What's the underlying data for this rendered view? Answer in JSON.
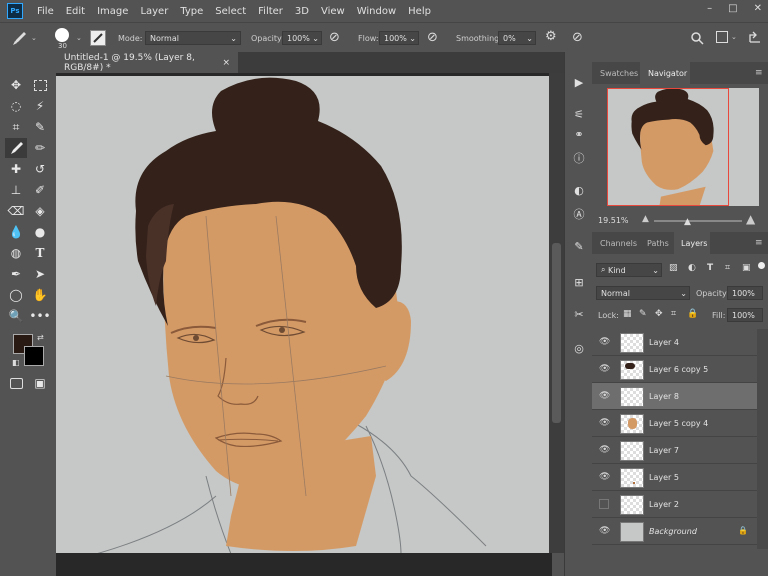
{
  "menubar": {
    "logo": "Ps",
    "items": [
      "File",
      "Edit",
      "Image",
      "Layer",
      "Type",
      "Select",
      "Filter",
      "3D",
      "View",
      "Window",
      "Help"
    ],
    "window_controls": [
      "–",
      "□",
      "✕"
    ]
  },
  "options": {
    "brush_size": "30",
    "mode_label": "Mode:",
    "mode_value": "Normal",
    "opacity_label": "Opacity:",
    "opacity_value": "100%",
    "flow_label": "Flow:",
    "flow_value": "100%",
    "smoothing_label": "Smoothing:",
    "smoothing_value": "0%"
  },
  "document": {
    "tab_title": "Untitled-1 @ 19.5% (Layer 8, RGB/8#) *",
    "close": "×"
  },
  "navigator": {
    "tabs": [
      "Swatches",
      "Navigator"
    ],
    "zoom": "19.51%"
  },
  "layers_panel": {
    "tabs": [
      "Channels",
      "Paths",
      "Layers"
    ],
    "filter_value": "Kind",
    "blend_mode": "Normal",
    "opacity_label": "Opacity:",
    "opacity_value": "100%",
    "lock_label": "Lock:",
    "fill_label": "Fill:",
    "fill_value": "100%",
    "layers": [
      {
        "name": "Layer 4",
        "visible": true,
        "selected": false,
        "thumb": "empty"
      },
      {
        "name": "Layer 6 copy 5",
        "visible": true,
        "selected": false,
        "thumb": "hair"
      },
      {
        "name": "Layer 8",
        "visible": true,
        "selected": true,
        "thumb": "empty"
      },
      {
        "name": "Layer 5 copy 4",
        "visible": true,
        "selected": false,
        "thumb": "skin"
      },
      {
        "name": "Layer 7",
        "visible": true,
        "selected": false,
        "thumb": "empty"
      },
      {
        "name": "Layer 5",
        "visible": true,
        "selected": false,
        "thumb": "dot"
      },
      {
        "name": "Layer 2",
        "visible": false,
        "selected": false,
        "thumb": "empty"
      },
      {
        "name": "Background",
        "visible": true,
        "selected": false,
        "thumb": "solid",
        "locked": true
      }
    ]
  },
  "colors": {
    "foreground": "#2a1a14",
    "background": "#000000",
    "accent_nav_frame": "#e8473c",
    "skin": "#d49a66",
    "hair": "#33211a",
    "canvas_bg": "#c5c8c6"
  }
}
